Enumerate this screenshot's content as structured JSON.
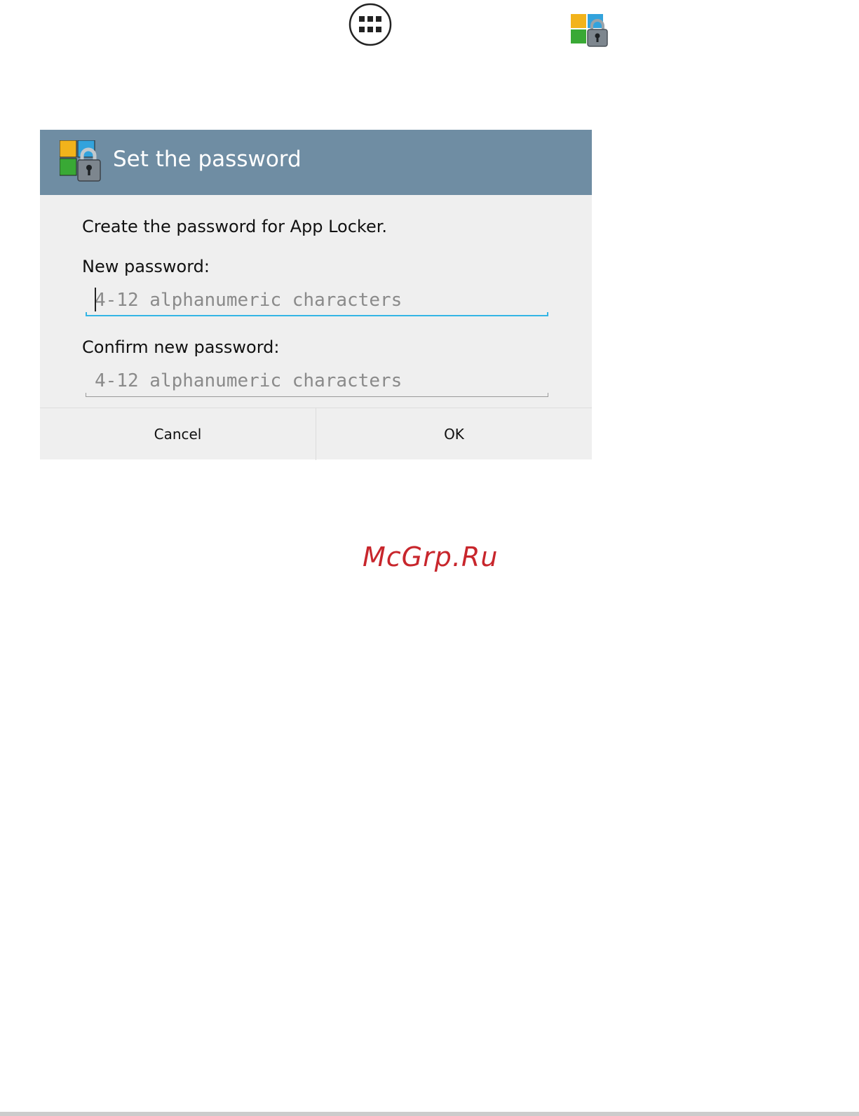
{
  "top_icons": {
    "apps_icon": "apps-grid-icon",
    "app_locker_icon": "app-locker-icon"
  },
  "dialog": {
    "title": "Set the password",
    "header_icon": "app-locker-icon",
    "message": "Create the password for App Locker.",
    "new_password": {
      "label": "New password:",
      "value": "",
      "placeholder": "4-12 alphanumeric characters",
      "focused": true
    },
    "confirm_password": {
      "label": "Confirm new password:",
      "value": "",
      "placeholder": "4-12 alphanumeric characters"
    },
    "buttons": {
      "cancel": "Cancel",
      "ok": "OK"
    }
  },
  "watermark": "McGrp.Ru",
  "colors": {
    "header": "#6f8da3",
    "dialog_bg": "#efefef",
    "focus_accent": "#33b5e5",
    "watermark": "#c8262c"
  }
}
